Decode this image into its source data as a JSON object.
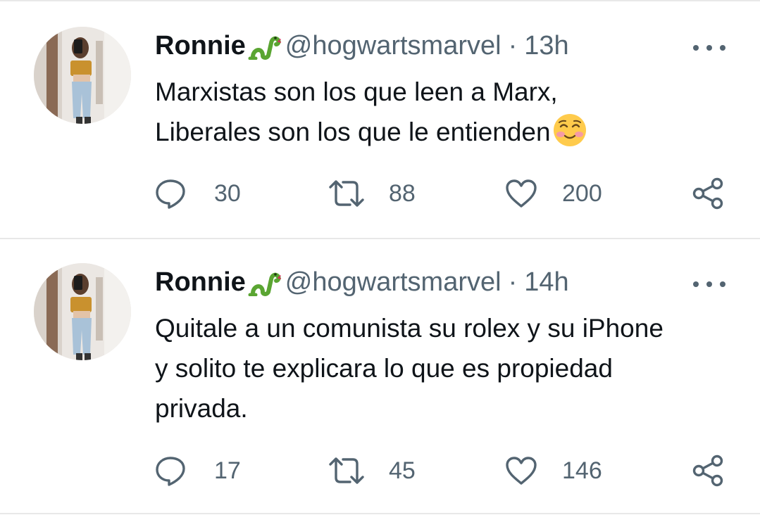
{
  "tweets": [
    {
      "author": {
        "name": "Ronnie",
        "badge_icon": "snake-emoji",
        "handle": "@hogwartsmarvel"
      },
      "separator": "·",
      "time": "13h",
      "text_lines": [
        "Marxistas son los que leen a Marx,",
        "Liberales son los que le entienden"
      ],
      "trailing_emoji": "smiling-face-with-blush-emoji",
      "stats": {
        "replies": "30",
        "retweets": "88",
        "likes": "200"
      }
    },
    {
      "author": {
        "name": "Ronnie",
        "badge_icon": "snake-emoji",
        "handle": "@hogwartsmarvel"
      },
      "separator": "·",
      "time": "14h",
      "text_lines": [
        "Quitale a un comunista su rolex y su iPhone",
        "y solito te explicara lo que es propiedad",
        "privada."
      ],
      "stats": {
        "replies": "17",
        "retweets": "45",
        "likes": "146"
      }
    }
  ],
  "colors": {
    "text_primary": "#0f1419",
    "text_secondary": "#536471",
    "divider": "#e8e8e8",
    "snake_green": "#5aa532"
  }
}
